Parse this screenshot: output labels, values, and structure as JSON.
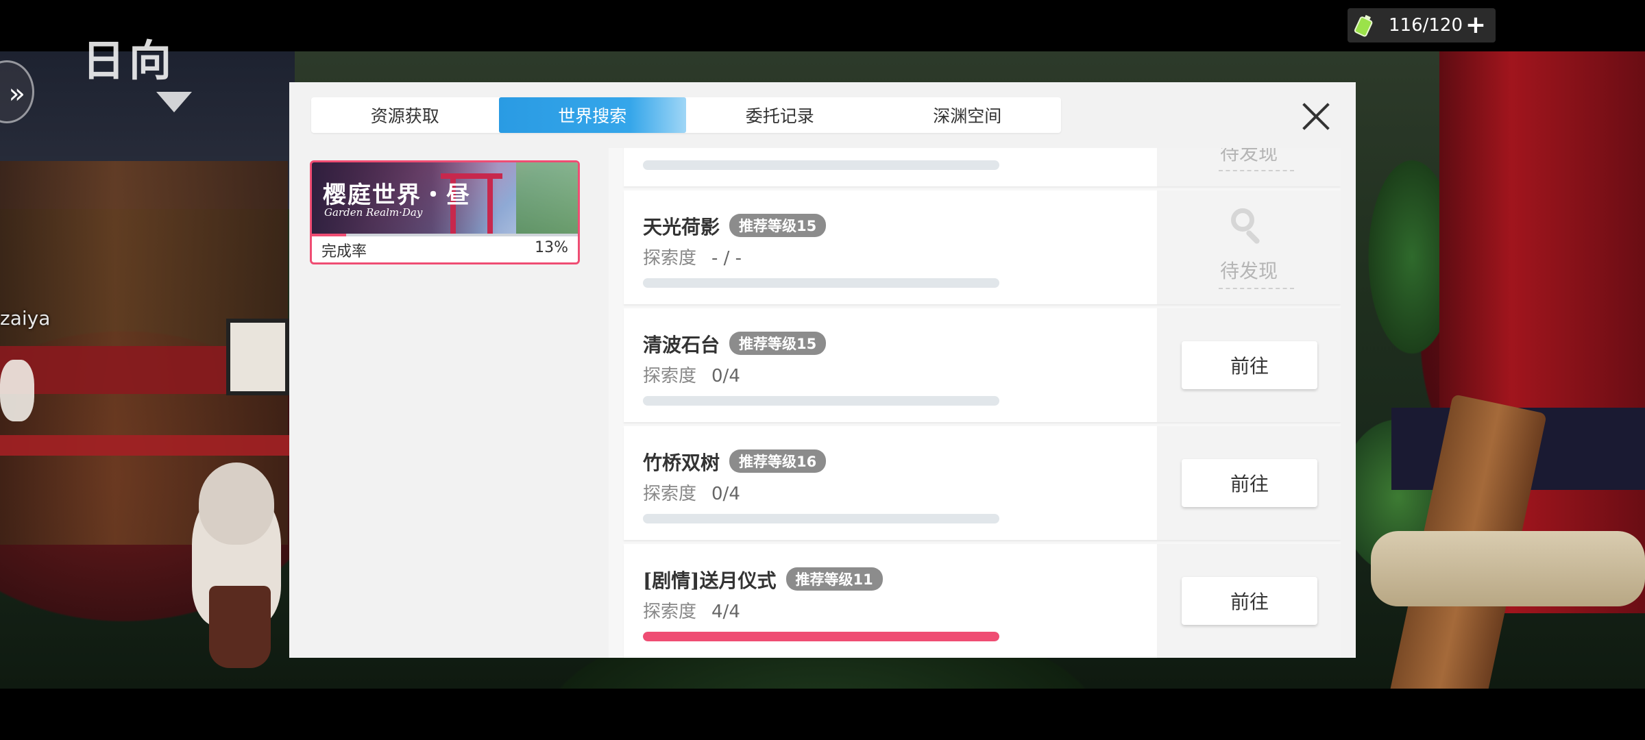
{
  "hud": {
    "location_partial": "日向",
    "player_name": "zaiya",
    "stamina": "116/120",
    "stamina_plus": "+"
  },
  "tabs": [
    {
      "label": "资源获取",
      "active": false
    },
    {
      "label": "世界搜索",
      "active": true
    },
    {
      "label": "委托记录",
      "active": false
    },
    {
      "label": "深渊空间",
      "active": false
    }
  ],
  "region": {
    "name": "樱庭世界・昼",
    "subtitle": "Garden Realm·Day",
    "completion_label": "完成率",
    "completion_value": "13%",
    "completion_fraction": 0.13
  },
  "list": {
    "top_partial": {
      "status": "待发现",
      "progress_fraction": 0
    },
    "items": [
      {
        "title": "天光荷影",
        "level": "推荐等级15",
        "explore_label": "探索度",
        "explore_value": "- / -",
        "progress_fraction": 0,
        "state": "undiscovered",
        "status": "待发现"
      },
      {
        "title": "清波石台",
        "level": "推荐等级15",
        "explore_label": "探索度",
        "explore_value": "0/4",
        "progress_fraction": 0,
        "state": "go",
        "action": "前往"
      },
      {
        "title": "竹桥双树",
        "level": "推荐等级16",
        "explore_label": "探索度",
        "explore_value": "0/4",
        "progress_fraction": 0,
        "state": "go",
        "action": "前往"
      },
      {
        "title": "[剧情]送月仪式",
        "level": "推荐等级11",
        "explore_label": "探索度",
        "explore_value": "4/4",
        "progress_fraction": 1,
        "state": "go",
        "action": "前往"
      }
    ]
  },
  "colors": {
    "accent_blue": "#2a9be3",
    "accent_pink": "#ef4d73",
    "badge_gray": "#8c8c8c"
  }
}
